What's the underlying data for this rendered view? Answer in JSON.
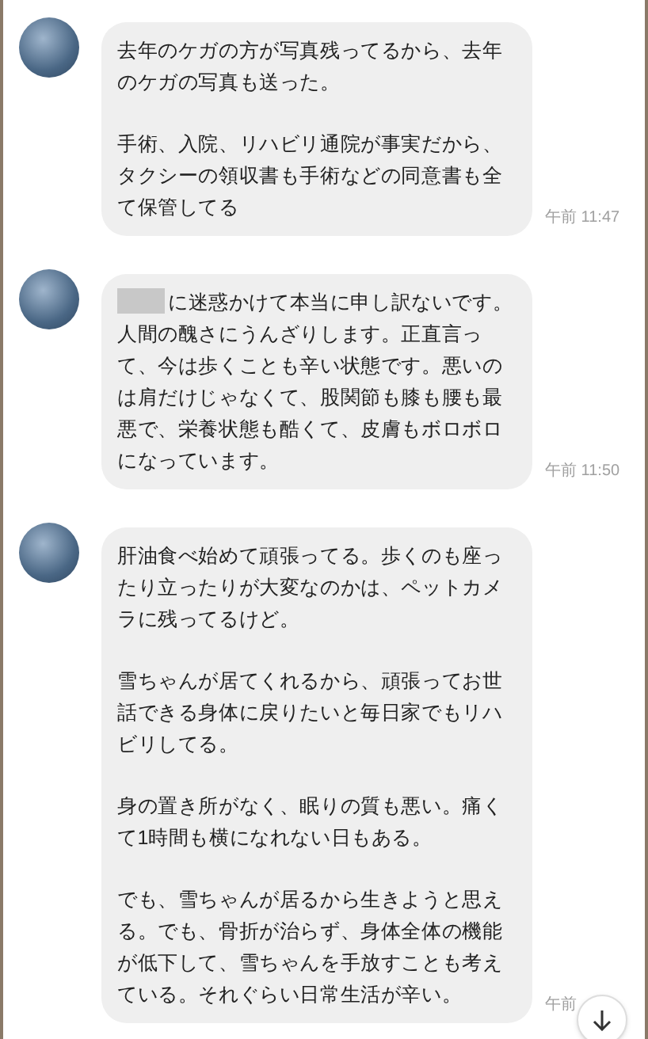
{
  "messages": [
    {
      "paragraphs": [
        "去年のケガの方が写真残ってるから、去年のケガの写真も送った。",
        "手術、入院、リハビリ通院が事実だから、タクシーの領収書も手術などの同意書も全て保管してる"
      ],
      "time": "午前 11:47"
    },
    {
      "redacted_prefix": true,
      "paragraphs": [
        "に迷惑かけて本当に申し訳ないです。人間の醜さにうんざりします。正直言って、今は歩くことも辛い状態です。悪いのは肩だけじゃなくて、股関節も膝も腰も最悪で、栄養状態も酷くて、皮膚もボロボロになっています。"
      ],
      "time": "午前 11:50"
    },
    {
      "paragraphs": [
        "肝油食べ始めて頑張ってる。歩くのも座ったり立ったりが大変なのかは、ペットカメラに残ってるけど。",
        "雪ちゃんが居てくれるから、頑張ってお世話できる身体に戻りたいと毎日家でもリハビリしてる。",
        "身の置き所がなく、眠りの質も悪い。痛くて1時間も横になれない日もある。",
        "でも、雪ちゃんが居るから生きようと思える。でも、骨折が治らず、身体全体の機能が低下して、雪ちゃんを手放すことも考えている。それぐらい日常生活が辛い。"
      ],
      "time": "午前"
    }
  ]
}
